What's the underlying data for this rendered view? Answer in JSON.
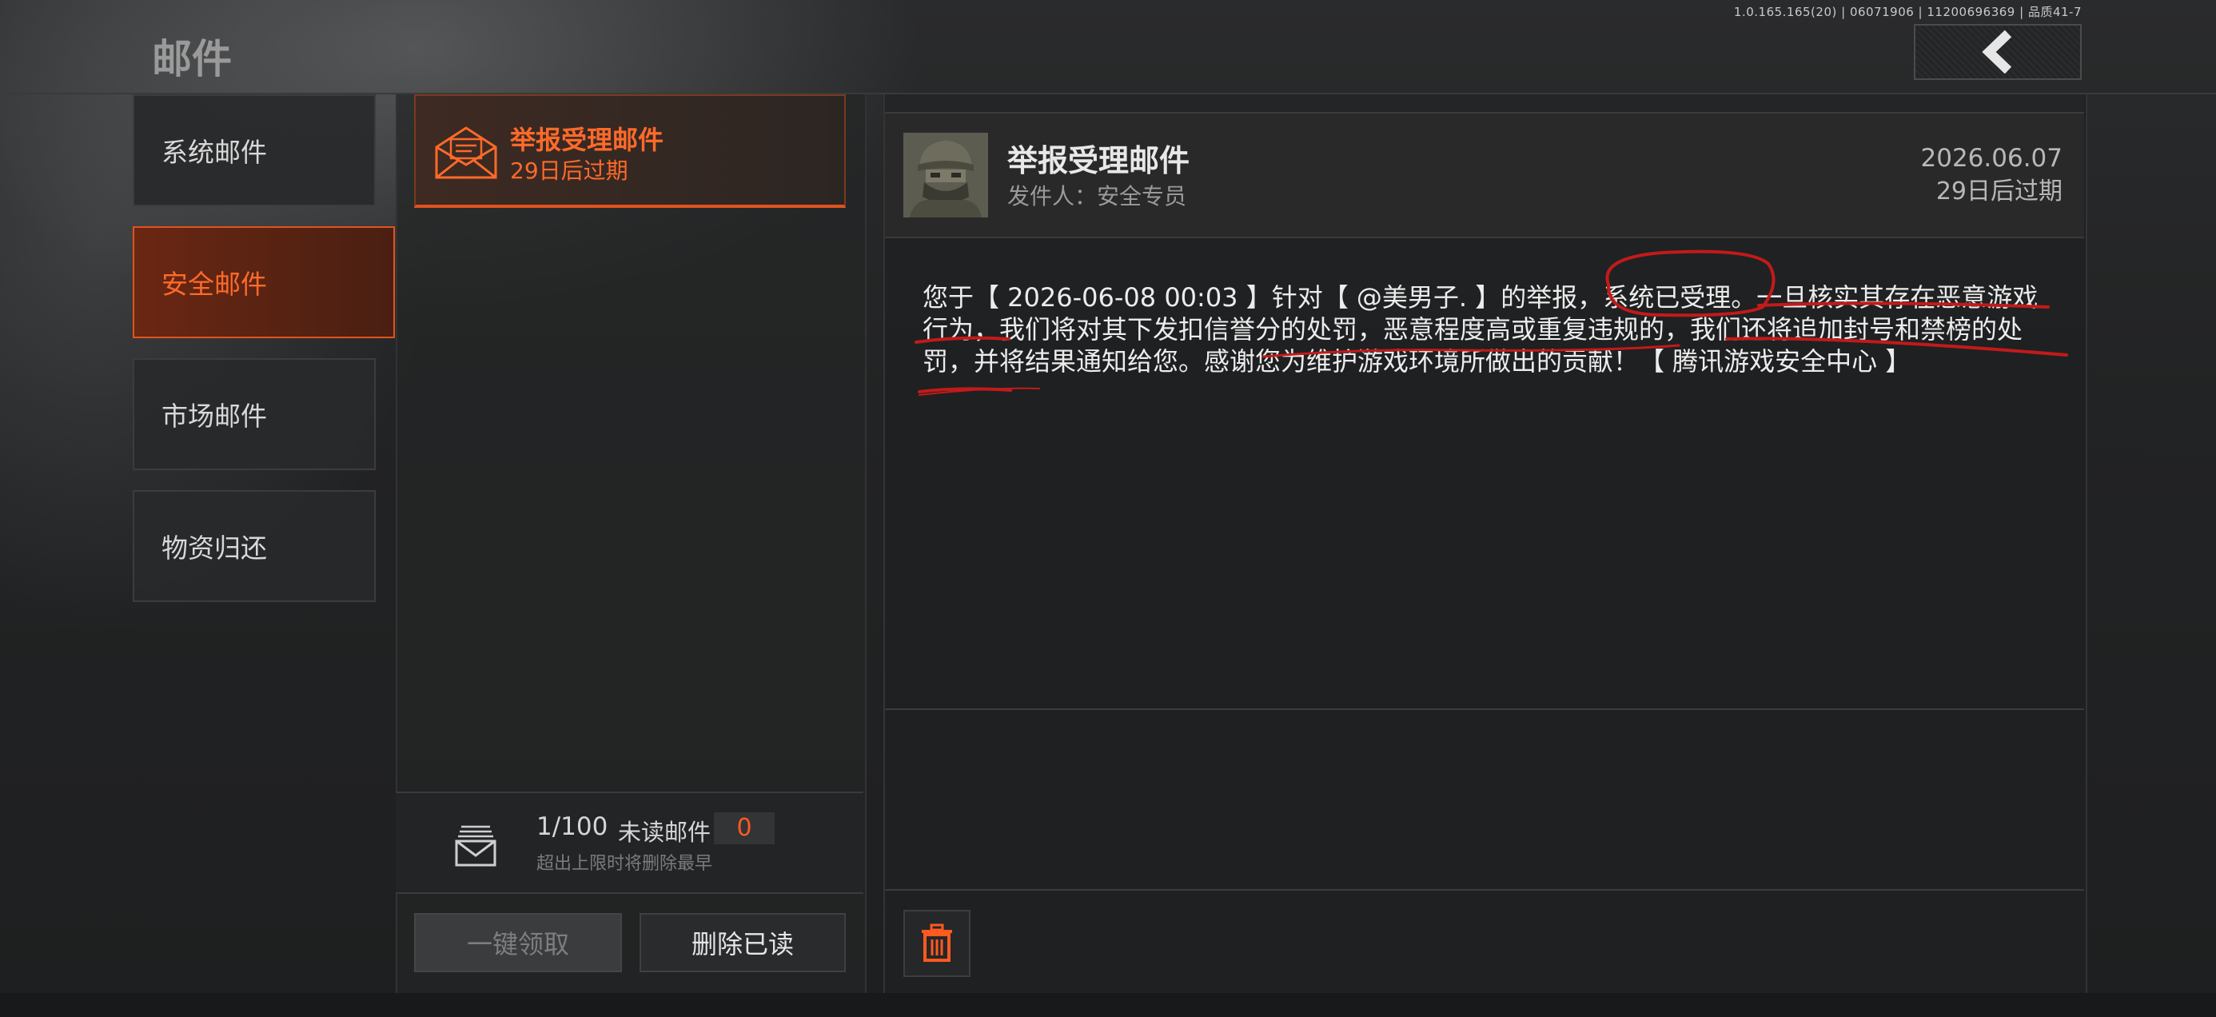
{
  "version_text": "1.0.165.165(20) | 06071906 | 11200696369 | 品质41-7",
  "page_title": "邮件",
  "sidebar": {
    "items": [
      {
        "label": "系统邮件"
      },
      {
        "label": "安全邮件",
        "active": true
      },
      {
        "label": "市场邮件"
      },
      {
        "label": "物资归还"
      }
    ]
  },
  "mail_list": {
    "items": [
      {
        "title": "举报受理邮件",
        "expire": "29日后过期",
        "icon": "envelope-icon"
      }
    ],
    "count": "1/100",
    "unread_label": "未读邮件",
    "unread_count": "0",
    "limit_note": "超出上限时将删除最早",
    "claim_all_label": "一键领取",
    "delete_read_label": "删除已读"
  },
  "detail": {
    "title": "举报受理邮件",
    "sender": "发件人：安全专员",
    "date": "2026.06.07",
    "expire": "29日后过期",
    "body": "您于【 2026-06-08 00:03 】针对【 @美男子. 】的举报，系统已受理。一旦核实其存在恶意游戏行为，我们将对其下发扣信誉分的处罚，恶意程度高或重复违规的，我们还将追加封号和禁榜的处罚，并将结果通知给您。感谢您为维护游戏环境所做出的贡献！【 腾讯游戏安全中心 】"
  },
  "colors": {
    "accent": "#ff6a2a",
    "accent_border": "#e0531f",
    "annotation_red": "#c21a1a"
  },
  "icons": [
    "back-arrow-icon",
    "envelope-icon",
    "mail-stack-icon",
    "trash-icon"
  ]
}
